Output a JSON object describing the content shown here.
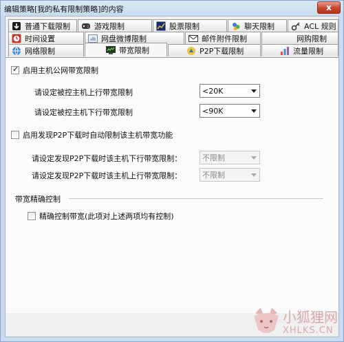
{
  "window": {
    "title": "编辑策略[我的私有限制策略]的内容",
    "close_label": "x"
  },
  "tabs": {
    "row1": [
      {
        "label": "普通下载限制",
        "icon": "download-icon"
      },
      {
        "label": "游戏限制",
        "icon": "game-controller-icon"
      },
      {
        "label": "股票限制",
        "icon": "stock-chart-icon"
      },
      {
        "label": "聊天限制",
        "icon": "chat-icon"
      },
      {
        "label": "ACL 规则",
        "icon": "key-icon"
      }
    ],
    "row2": [
      {
        "label": "时间设置",
        "icon": "clock-icon"
      },
      {
        "label": "网盘微博限制",
        "icon": "cloud-icon"
      },
      {
        "label": "邮件附件限制",
        "icon": "mail-icon"
      },
      {
        "label": "网购限制",
        "icon": ""
      }
    ],
    "row3": [
      {
        "label": "网络限制",
        "icon": "globe-icon"
      },
      {
        "label": "带宽限制",
        "icon": "bandwidth-monitor-icon",
        "selected": true
      },
      {
        "label": "P2P下载限制",
        "icon": "p2p-icon"
      },
      {
        "label": "流量限制",
        "icon": "traffic-bars-icon"
      }
    ]
  },
  "bandwidth": {
    "enable_label": "启用主机公网带宽限制",
    "enable_checked": true,
    "upload_label": "请设定被控主机上行带宽限制",
    "upload_value": "<20K",
    "download_label": "请设定被控主机下行带宽限制",
    "download_value": "<90K"
  },
  "p2p": {
    "enable_label": "启用发现P2P下载时自动限制该主机带宽功能",
    "enable_checked": false,
    "download_label": "请设定发现P2P下载时该主机下行带宽限制：",
    "download_value": "不限制",
    "upload_label": "请设定发现P2P下载时该主机上行带宽限制：",
    "upload_value": "不限制"
  },
  "precise": {
    "group_label": "带宽精确控制",
    "checkbox_label": "精确控制带宽(此项对上述两项均有控制)",
    "checked": false
  },
  "watermark": {
    "text": "小狐狸网",
    "sub": "XHLKS.CN"
  },
  "colors": {
    "title_bar": "#c7dbee",
    "close_button": "#c9452c",
    "panel": "#fbfbfb"
  }
}
